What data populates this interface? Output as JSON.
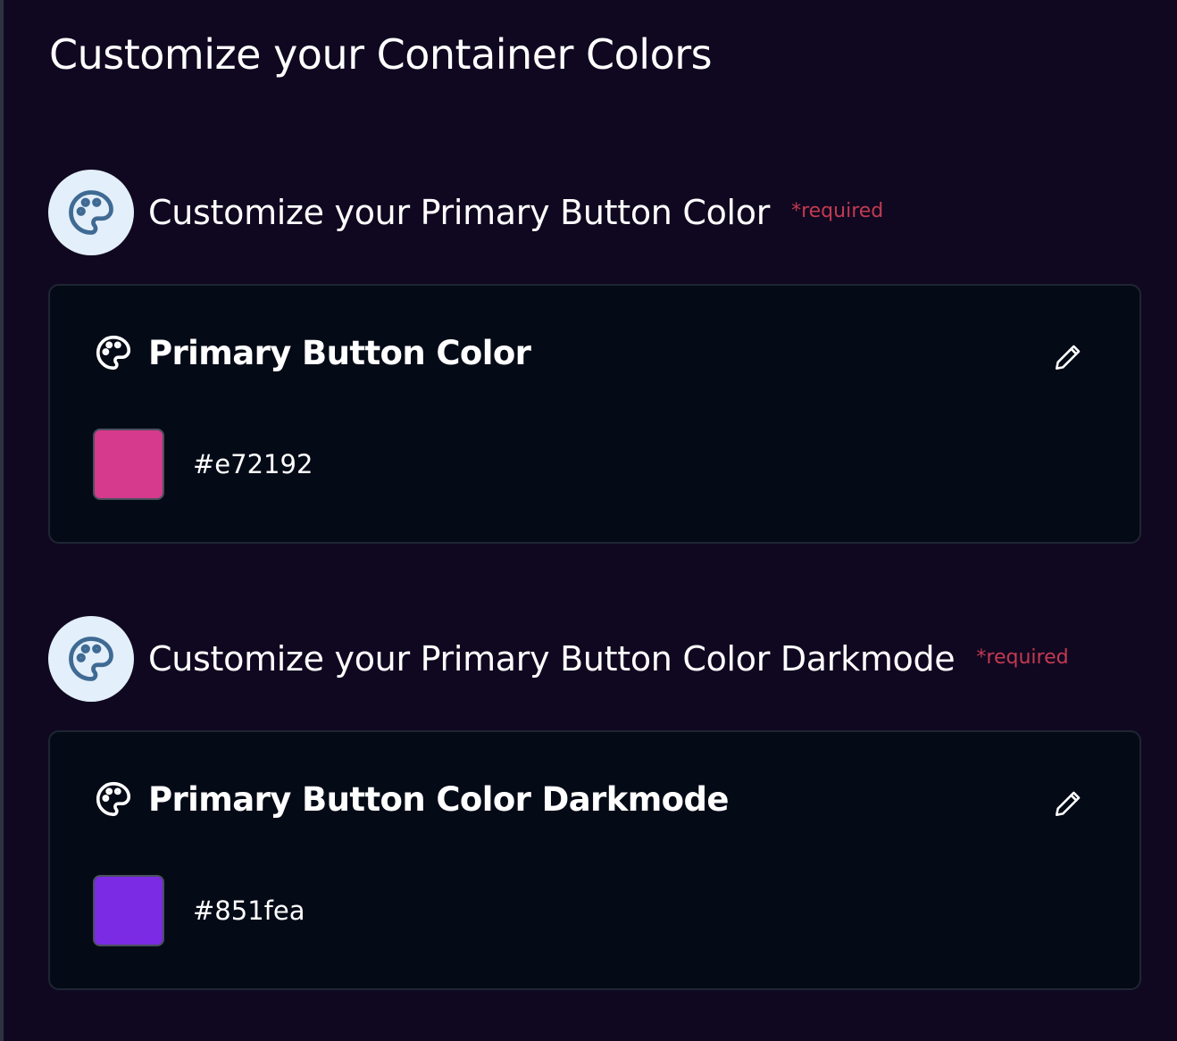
{
  "page": {
    "title": "Customize your Container Colors"
  },
  "theme": {
    "background": "#100820",
    "card_background": "#050a17",
    "icon_circle_bg": "#e3effa",
    "icon_color": "#3f6a93",
    "required_color": "#c23a52"
  },
  "sections": [
    {
      "header_title": "Customize your Primary Button Color",
      "required_label": "*required",
      "header_icon": "palette-icon",
      "card": {
        "title": "Primary Button Color",
        "title_icon": "palette-icon",
        "edit_icon": "pencil-icon",
        "hex_value": "#e72192",
        "swatch_color": "#d63a8c"
      }
    },
    {
      "header_title": "Customize your Primary Button Color Darkmode",
      "required_label": "*required",
      "header_icon": "palette-icon",
      "card": {
        "title": "Primary Button Color Darkmode",
        "title_icon": "palette-icon",
        "edit_icon": "pencil-icon",
        "hex_value": "#851fea",
        "swatch_color": "#7b2be3"
      }
    }
  ]
}
